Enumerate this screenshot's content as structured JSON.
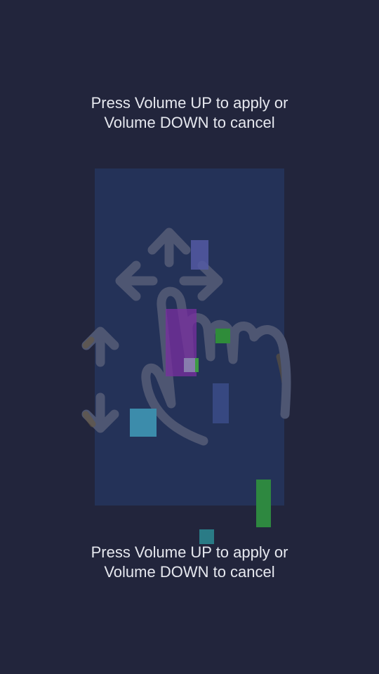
{
  "instruction_top": {
    "line1": "Press Volume UP to apply or",
    "line2": "Volume DOWN to cancel"
  },
  "instruction_bottom": {
    "line1": "Press Volume UP to apply or",
    "line2": "Volume DOWN to cancel"
  },
  "colors": {
    "background": "#22253c",
    "preview_frame": "#243258",
    "text": "#e6e8ef"
  },
  "icons": [
    "move-arrows-icon",
    "vertical-resize-arrows-icon",
    "hand-gesture-icon"
  ]
}
